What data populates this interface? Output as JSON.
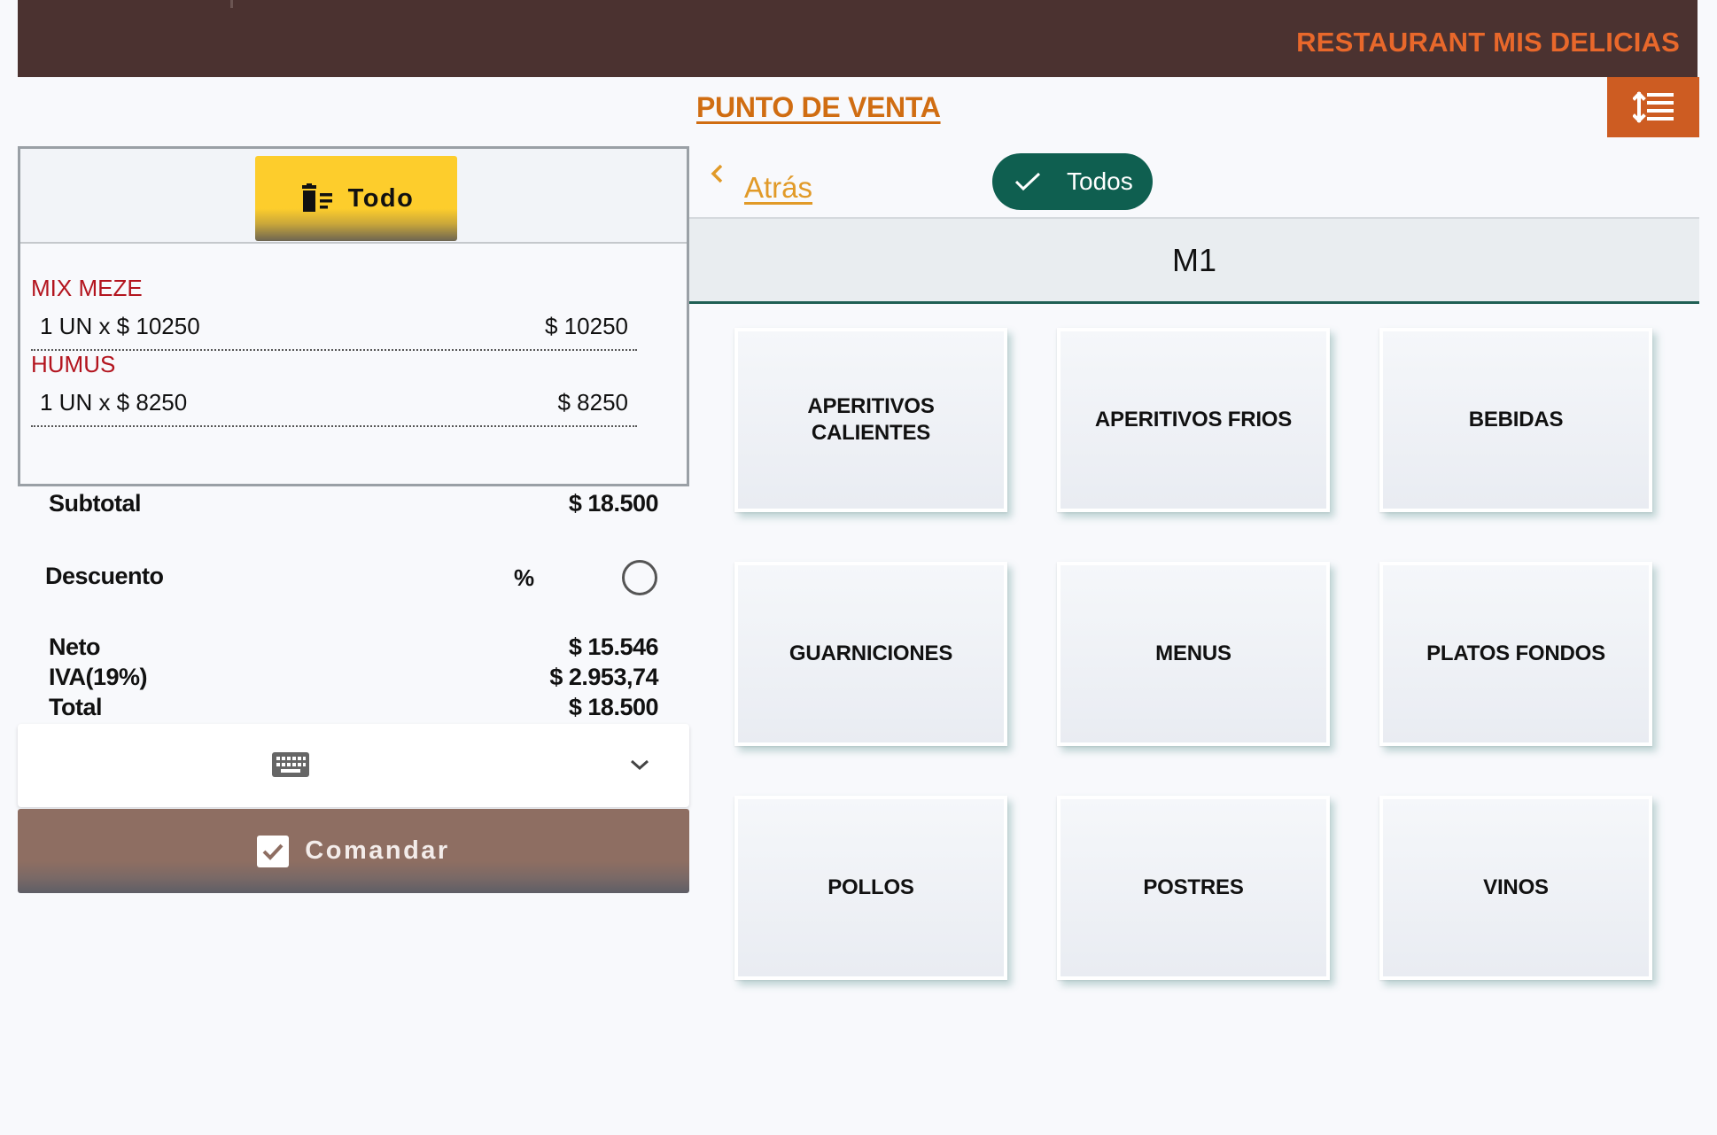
{
  "header": {
    "brand": "RESTAURANT MIS DELICIAS",
    "page_title": "PUNTO DE VENTA",
    "sort_icon": "sort-lines-icon"
  },
  "order": {
    "clear_label": "Todo",
    "clear_icon": "trash-list-icon",
    "items": [
      {
        "name": "MIX MEZE",
        "qty_text": "1 UN x $ 10250",
        "amount": "$ 10250"
      },
      {
        "name": "HUMUS",
        "qty_text": "1 UN x $ 8250",
        "amount": "$ 8250"
      }
    ]
  },
  "summary": {
    "subtotal_label": "Subtotal",
    "subtotal_value": "$ 18.500",
    "discount_label": "Descuento",
    "discount_symbol": "%",
    "neto_label": "Neto",
    "neto_value": "$ 15.546",
    "iva_label": "IVA(19%)",
    "iva_value": "$ 2.953,74",
    "total_label": "Total",
    "total_value": "$ 18.500"
  },
  "actions": {
    "keyboard_icon": "keyboard-icon",
    "expand_icon": "chevron-down-icon",
    "comandar_label": "Comandar"
  },
  "nav": {
    "back_label": "Atrás",
    "filter_label": "Todos"
  },
  "section_title": "M1",
  "categories": [
    {
      "label": "APERITIVOS CALIENTES"
    },
    {
      "label": "APERITIVOS FRIOS"
    },
    {
      "label": "BEBIDAS"
    },
    {
      "label": "GUARNICIONES"
    },
    {
      "label": "MENUS"
    },
    {
      "label": "PLATOS FONDOS"
    },
    {
      "label": "POLLOS"
    },
    {
      "label": "POSTRES"
    },
    {
      "label": "VINOS"
    }
  ],
  "colors": {
    "topbar": "#4b3230",
    "brand": "#e8682b",
    "accent_orange": "#cd5c22",
    "clear_btn": "#fdcd2c",
    "chip": "#0f5f50",
    "comandar": "#8e6e62",
    "item_name": "#b3141e"
  }
}
